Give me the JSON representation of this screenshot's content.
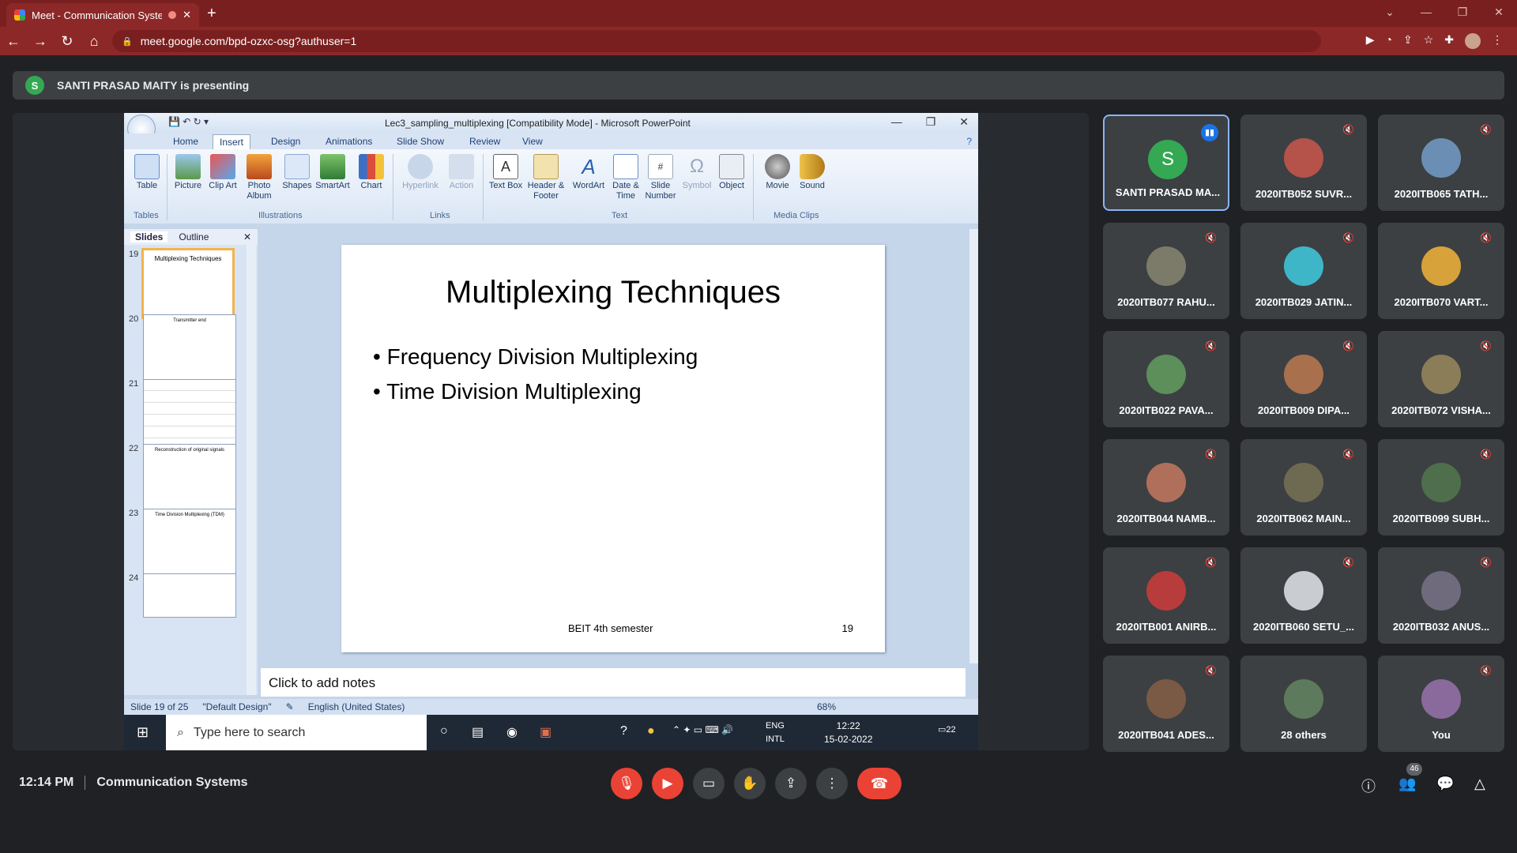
{
  "browser": {
    "tab_title": "Meet - Communication Syste",
    "url": "meet.google.com/bpd-ozxc-osg?authuser=1"
  },
  "presenting": {
    "initial": "S",
    "text": "SANTI PRASAD MAITY is presenting"
  },
  "ppt": {
    "window_title": "Lec3_sampling_multiplexing [Compatibility Mode] - Microsoft PowerPoint",
    "tabs": [
      "Home",
      "Insert",
      "Design",
      "Animations",
      "Slide Show",
      "Review",
      "View"
    ],
    "active_tab": "Insert",
    "ribbon": {
      "table": "Table",
      "picture": "Picture",
      "clip_art": "Clip Art",
      "photo_album": "Photo Album",
      "shapes": "Shapes",
      "smartart": "SmartArt",
      "chart": "Chart",
      "hyperlink": "Hyperlink",
      "action": "Action",
      "text_box": "Text Box",
      "header_footer": "Header & Footer",
      "wordart": "WordArt",
      "date_time": "Date & Time",
      "slide_number": "Slide Number",
      "symbol": "Symbol",
      "object": "Object",
      "movie": "Movie",
      "sound": "Sound"
    },
    "groups": {
      "tables": "Tables",
      "illustrations": "Illustrations",
      "links": "Links",
      "text": "Text",
      "media": "Media Clips"
    },
    "panel_tabs": {
      "slides": "Slides",
      "outline": "Outline"
    },
    "thumbnails": [
      {
        "num": "19",
        "title": "Multiplexing Techniques"
      },
      {
        "num": "20",
        "title": "Transmitter end"
      },
      {
        "num": "21",
        "title": ""
      },
      {
        "num": "22",
        "title": "Reconstruction of original signals"
      },
      {
        "num": "23",
        "title": "Time Division Multiplexing (TDM)"
      },
      {
        "num": "24",
        "title": ""
      }
    ],
    "slide": {
      "title": "Multiplexing Techniques",
      "bullets": [
        "Frequency Division Multiplexing",
        "Time Division Multiplexing"
      ],
      "footer": "BEIT 4th semester",
      "number": "19"
    },
    "notes_placeholder": "Click to add notes",
    "status": {
      "slide_pos": "Slide 19 of 25",
      "design": "\"Default Design\"",
      "language": "English (United States)",
      "zoom": "68%"
    }
  },
  "windows_taskbar": {
    "search_placeholder": "Type here to search",
    "lang1": "ENG",
    "lang2": "INTL",
    "time": "12:22",
    "date": "15-02-2022",
    "notif": "22"
  },
  "participants": [
    {
      "name": "SANTI PRASAD MA...",
      "color": "#34a853",
      "initial": "S"
    },
    {
      "name": "2020ITB052 SUVR...",
      "color": "#b5534a"
    },
    {
      "name": "2020ITB065 TATH...",
      "color": "#6b8fb4"
    },
    {
      "name": "2020ITB077 RAHU...",
      "color": "#7c7b6a"
    },
    {
      "name": "2020ITB029 JATIN...",
      "color": "#3fb6c8"
    },
    {
      "name": "2020ITB070 VART...",
      "color": "#d7a23a"
    },
    {
      "name": "2020ITB022 PAVA...",
      "color": "#5c8f5a"
    },
    {
      "name": "2020ITB009 DIPA...",
      "color": "#a8704d"
    },
    {
      "name": "2020ITB072 VISHA...",
      "color": "#8a7d58"
    },
    {
      "name": "2020ITB044 NAMB...",
      "color": "#b06f5b"
    },
    {
      "name": "2020ITB062 MAIN...",
      "color": "#6e6a52"
    },
    {
      "name": "2020ITB099 SUBH...",
      "color": "#4f6e4b"
    },
    {
      "name": "2020ITB001 ANIRB...",
      "color": "#b83c3c"
    },
    {
      "name": "2020ITB060 SETU_...",
      "color": "#c9ccd0"
    },
    {
      "name": "2020ITB032 ANUS...",
      "color": "#6f6a7c"
    },
    {
      "name": "2020ITB041 ADES...",
      "color": "#7a5a45"
    },
    {
      "name": "28 others",
      "color": "#5e7a5c"
    },
    {
      "name": "You",
      "color": "#8a6a9c"
    }
  ],
  "meeting": {
    "time": "12:14 PM",
    "name": "Communication Systems",
    "people_count": "46"
  },
  "colors": {
    "chrome": "#8d2828",
    "meet_bg": "#202124",
    "danger": "#ea4335"
  }
}
